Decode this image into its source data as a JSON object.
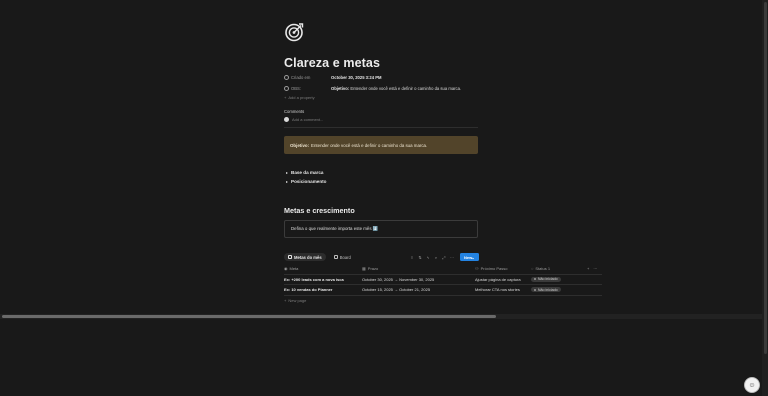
{
  "page": {
    "icon": "target-icon",
    "title": "Clareza e metas"
  },
  "properties": [
    {
      "icon": "clock-icon",
      "label": "Criado em",
      "value": "October 30, 2025 3:24 PM",
      "bold_prefix": ""
    },
    {
      "icon": "eye-icon",
      "label": "OBS:",
      "value": "Entender onde você está e definir o caminho da sua marca.",
      "bold_prefix": "Objetivo:"
    }
  ],
  "add_property": {
    "label": "Add a property"
  },
  "comments": {
    "heading": "Comments",
    "placeholder": "Add a comment..."
  },
  "callout": {
    "bold": "Objetivo:",
    "text": "Entender onde você está e definir o caminho da sua marca.",
    "background": "#52442a"
  },
  "toggles": [
    {
      "label": "Base da marca"
    },
    {
      "label": "Posicionamento"
    }
  ],
  "section": {
    "heading": "Metas e crescimento",
    "prompt": "Defina o que realmente importa este mês ⬇️"
  },
  "database": {
    "tabs": [
      {
        "label": "Metas do mês",
        "icon": "table-icon",
        "active": true
      },
      {
        "label": "Board",
        "icon": "board-icon",
        "active": false
      }
    ],
    "toolbar": {
      "icons": [
        "filter-icon",
        "sort-icon",
        "lightning-icon",
        "search-icon",
        "expand-icon",
        "settings-icon"
      ],
      "new_label": "New",
      "accent": "#2383e2"
    },
    "columns": [
      {
        "icon": "eye-icon",
        "label": "Meta"
      },
      {
        "icon": "calendar-icon",
        "label": "Prazo"
      },
      {
        "icon": "people-icon",
        "label": "Próximo Passo"
      },
      {
        "icon": "status-icon",
        "label": "Status 1"
      }
    ],
    "rows": [
      {
        "meta": "Ex: +200 leads com a nova isca",
        "prazo": "October 30, 2025 → November 30, 2025",
        "proximo": "Ajustar página de captura",
        "status": "Não iniciado"
      },
      {
        "meta": "Ex: 10 vendas do Planner",
        "prazo": "October 15, 2025 → October 21, 2025",
        "proximo": "Melhorar CTA nos stories",
        "status": "Não iniciado"
      }
    ],
    "new_page_label": "New page"
  }
}
